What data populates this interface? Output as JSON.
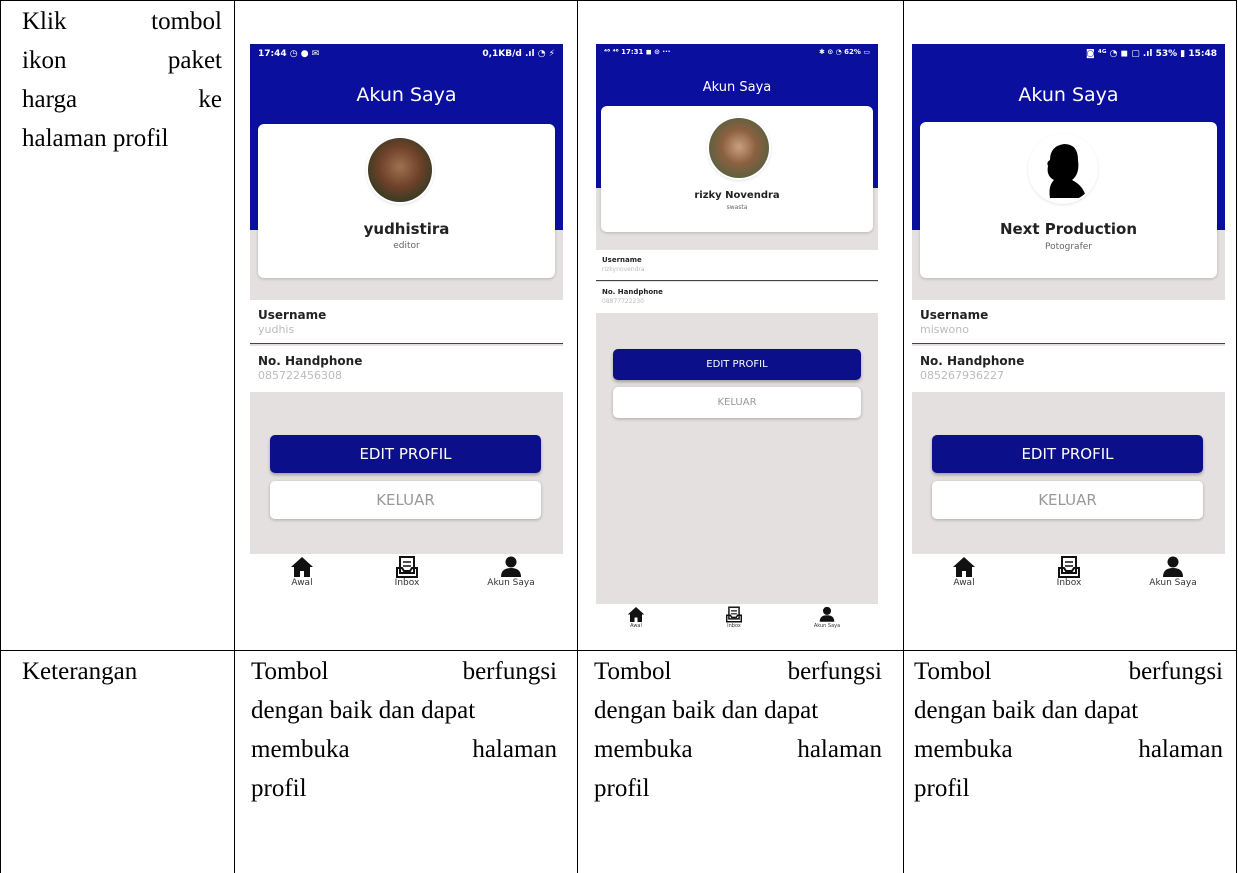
{
  "table": {
    "row1_label": [
      "Klik|tombol",
      "ikon|paket",
      "harga|ke",
      "halaman profil"
    ],
    "row2_label": "Keterangan",
    "result_lines": [
      "Tombol|berfungsi",
      "dengan baik dan dapat",
      "membuka|halaman",
      "profil"
    ]
  },
  "phones": [
    {
      "status_left": "17:44 ◷ ● ✉",
      "status_right": "0,1KB/d .ıl ◔ ⚡",
      "title": "Akun Saya",
      "name": "yudhistira",
      "role": "editor",
      "username_label": "Username",
      "username_value": "yudhis",
      "phone_label": "No. Handphone",
      "phone_value": "085722456308",
      "edit_label": "EDIT PROFIL",
      "logout_label": "KELUAR",
      "nav": [
        "Awal",
        "Inbox",
        "Akun Saya"
      ]
    },
    {
      "status_left": "⁴⁶ ⁴⁶ 17:31 ◼ ⊙ ···",
      "status_right": "✱ ⊙ ◔ 62% ▭",
      "title": "Akun Saya",
      "name": "rizky Novendra",
      "role": "swasta",
      "username_label": "Username",
      "username_value": "rizkynovendra",
      "phone_label": "No. Handphone",
      "phone_value": "08877722230",
      "edit_label": "EDIT PROFIL",
      "logout_label": "KELUAR",
      "nav": [
        "Awal",
        "Inbox",
        "Akun Saya"
      ]
    },
    {
      "status_left": "",
      "status_right": "◙ ⁴ᴳ ◔ ◼ ▢ .ıl 53% ▮ 15:48",
      "title": "Akun Saya",
      "name": "Next Production",
      "role": "Potografer",
      "username_label": "Username",
      "username_value": "miswono",
      "phone_label": "No. Handphone",
      "phone_value": "085267936227",
      "edit_label": "EDIT PROFIL",
      "logout_label": "KELUAR",
      "nav": [
        "Awal",
        "Inbox",
        "Akun Saya"
      ]
    }
  ],
  "colors": {
    "appbar": "#0b0f9e",
    "button": "#0b0f8a",
    "background": "#e5e0e0"
  },
  "icons": [
    "home-icon",
    "inbox-icon",
    "user-icon"
  ]
}
